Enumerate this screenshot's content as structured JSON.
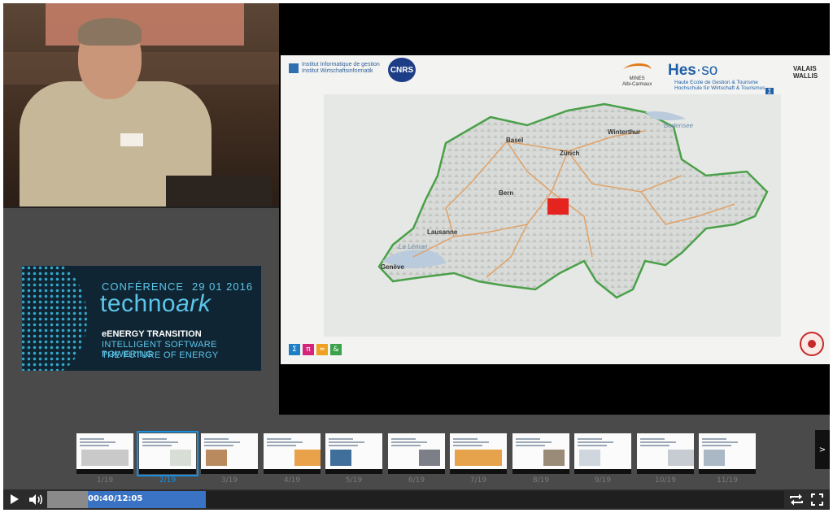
{
  "conference": {
    "title": "CONFÉRENCE",
    "date": "29 01 2016",
    "brand_main": "techno",
    "brand_accent": "ark",
    "tagline_1": "eENERGY TRANSITION",
    "tagline_2": "INTELLIGENT SOFTWARE POWERING",
    "tagline_3": "THE FUTURE OF ENERGY",
    "color_accent": "#5cc6ea",
    "color_bg": "#0f2533"
  },
  "slide": {
    "institute_line1": "Institut Informatique de gestion",
    "institute_line2": "Institut Wirtschaftsinformatik",
    "cnrs_logo": "CNRS",
    "mines_line1": "MINES",
    "mines_line2": "Albi-Carmaux",
    "hes_logo_main": "Hes",
    "hes_logo_sep": "·",
    "hes_logo_end": "so",
    "hes_region1": "VALAIS",
    "hes_region2": "WALLIS",
    "hes_sub1": "Haute Ecole de Gestion & Tourisme",
    "hes_sub2": "Hochschule für Wirtschaft & Tourismus",
    "map_cities": [
      "Basel",
      "Winterthur",
      "Zürich",
      "Bern",
      "Lausanne",
      "Genève",
      "Le Léman",
      "Bodensee"
    ],
    "footer_icons": [
      {
        "name": "sigma-icon",
        "glyph": "Σ",
        "color": "#1f7fc4"
      },
      {
        "name": "pi-icon",
        "glyph": "π",
        "color": "#d6247a"
      },
      {
        "name": "approx-icon",
        "glyph": "≈",
        "color": "#f0a020"
      },
      {
        "name": "ampersand-icon",
        "glyph": "&",
        "color": "#3aa24a"
      }
    ]
  },
  "thumbnails": [
    {
      "label": "1/19",
      "active": false
    },
    {
      "label": "2/19",
      "active": true
    },
    {
      "label": "3/19",
      "active": false
    },
    {
      "label": "4/19",
      "active": false
    },
    {
      "label": "5/19",
      "active": false
    },
    {
      "label": "6/19",
      "active": false
    },
    {
      "label": "7/19",
      "active": false
    },
    {
      "label": "8/19",
      "active": false
    },
    {
      "label": "9/19",
      "active": false
    },
    {
      "label": "10/19",
      "active": false
    },
    {
      "label": "11/19",
      "active": false
    }
  ],
  "thumbnails_next": ">",
  "player": {
    "timecode": "00:40/12:05",
    "played_fraction": 0.055,
    "buffered_fraction": 0.215,
    "accent_color": "#3b73c4"
  }
}
